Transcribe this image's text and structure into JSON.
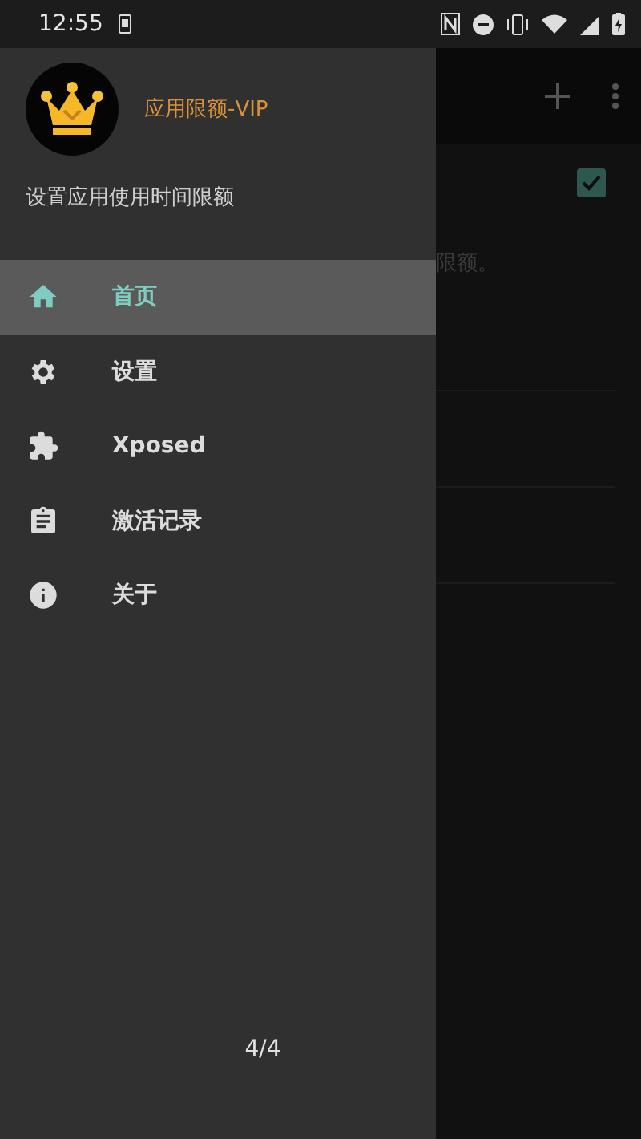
{
  "status_bar": {
    "time": "12:55"
  },
  "drawer": {
    "title": "应用限额-VIP",
    "subtitle": "设置应用使用时间限额",
    "items": [
      {
        "kind": "home",
        "label": "首页",
        "selected": true
      },
      {
        "kind": "settings",
        "label": "设置",
        "selected": false
      },
      {
        "kind": "puzzle",
        "label": "Xposed",
        "selected": false
      },
      {
        "kind": "clipboard",
        "label": "激活记录",
        "selected": false
      },
      {
        "kind": "info",
        "label": "关于",
        "selected": false
      }
    ],
    "page_indicator": "4/4"
  },
  "background": {
    "checkbox_checked": true,
    "text": "限额。"
  }
}
